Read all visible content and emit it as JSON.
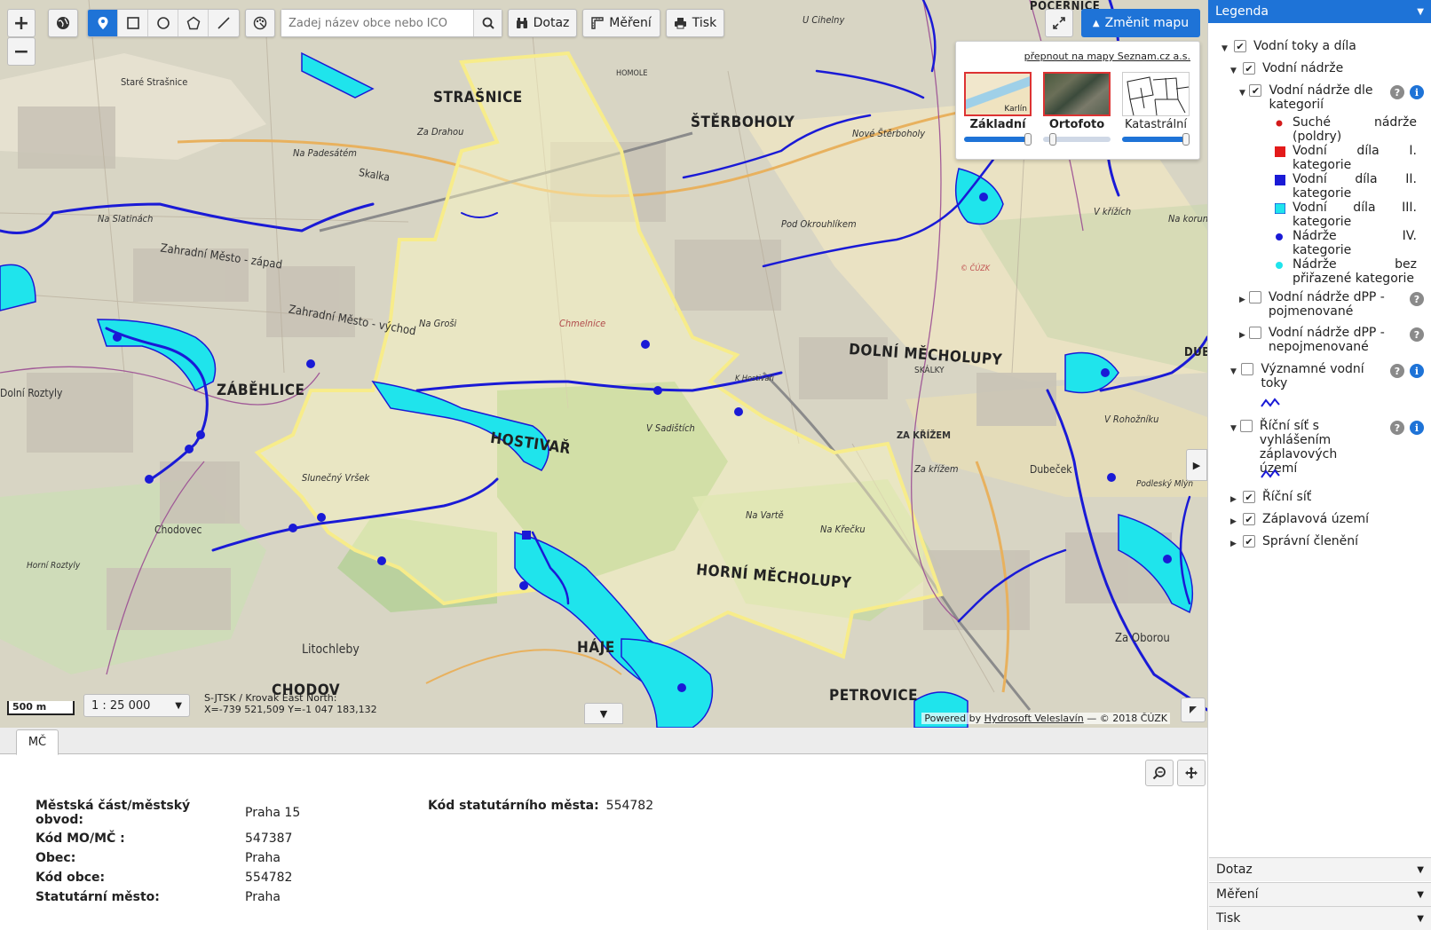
{
  "toolbar": {
    "zoom_in": "+",
    "zoom_out": "−",
    "search_placeholder": "Zadej název obce nebo IČO",
    "query_label": "Dotaz",
    "measure_label": "Měření",
    "print_label": "Tisk",
    "change_map_label": "Změnit mapu"
  },
  "switcher": {
    "link": "přepnout na mapy Seznam.cz a.s.",
    "options": [
      {
        "label": "Základní",
        "thumb_text": "Karlín",
        "opacity": 1.0
      },
      {
        "label": "Ortofoto",
        "opacity": 0.1
      },
      {
        "label": "Katastrální",
        "opacity": 1.0
      }
    ]
  },
  "map": {
    "labels": {
      "strasnice": "STRAŠNICE",
      "sterboholy": "ŠTĚRBOHOLY",
      "zabehlice": "ZÁBĚHLICE",
      "hostivar": "HOSTIVAŘ",
      "dolni_mecholupy": "DOLNÍ MĚCHOLUPY",
      "horni_mecholupy": "HORNÍ MĚCHOLUPY",
      "haje": "HÁJE",
      "chodov": "CHODOV",
      "petrovice": "PETROVICE",
      "pocernice": "POČERNICE",
      "dubec": "DUBEČ",
      "stare_strasnice": "Staré Strašnice",
      "zahradni_mesto_zapad": "Zahradní Město - západ",
      "zahradni_mesto_vychod": "Zahradní Město - východ",
      "skalka": "Skalka",
      "za_drahou": "Za Drahou",
      "na_padesatem": "Na Padesátém",
      "na_slatinach": "Na Slatinách",
      "na_grosi": "Na Groši",
      "chmelnice": "Chmelnice",
      "u_cihelny": "U Cihelny",
      "homole": "HOMOLE",
      "nove_sterboholy": "Nové Štěrboholy",
      "pod_okrouhlikem": "Pod Okrouhlíkem",
      "v_krizich": "V křížích",
      "na_korunce": "Na korunce",
      "skalky": "SKÁLKY",
      "za_krizem": "ZA KŘÍŽEM",
      "za_krizem2": "Za křížem",
      "v_sadistich": "V Sadištích",
      "slunecny_vrsek": "Slunečný Vršek",
      "chodovec": "Chodovec",
      "horni_roztyly": "Horní Roztyly",
      "dolni_roztyly": "Dolní Roztyly",
      "litochleby": "Litochleby",
      "na_varte": "Na Vartě",
      "na_krecku": "Na Křečku",
      "dubecek": "Dubeček",
      "podlesky_mlyn": "Podleský Mlýn",
      "za_oborou": "Za Oborou",
      "v_rohozniku": "V Rohožníku",
      "k_hostivari": "K Hostivaři",
      "cuzk": "© ČÚZK"
    },
    "scale_bar": "500 m",
    "scale_select": "1 : 25 000",
    "coords_line1": "S-JTSK / Krovak East North:",
    "coords_line2": "X=-739 521,509 Y=-1 047 183,132",
    "powered_prefix": "Powered by ",
    "powered_link": "Hydrosoft Veleslavín",
    "powered_suffix": " — © 2018 ČÚZK"
  },
  "info": {
    "tab": "MČ",
    "rows": [
      {
        "key": "Městská část/městský obvod:",
        "value": "Praha 15"
      },
      {
        "key": "Kód MO/MČ :",
        "value": "547387"
      },
      {
        "key": "Obec:",
        "value": "Praha"
      },
      {
        "key": "Kód obce:",
        "value": "554782"
      },
      {
        "key": "Statutární město:",
        "value": "Praha"
      }
    ],
    "extra_key": "Kód statutárního města:",
    "extra_value": "554782"
  },
  "legend": {
    "title": "Legenda",
    "items": {
      "vodni_toky": "Vodní toky a díla",
      "vodni_nadrze": "Vodní nádrže",
      "vodni_nadrze_kat": "Vodní nádrže dle kategorií",
      "sym_suche": "Suché nádrže (poldry)",
      "sym_kat1": "Vodní díla I. kategorie",
      "sym_kat2": "Vodní díla II. kategorie",
      "sym_kat3": "Vodní díla III. kategorie",
      "sym_kat4": "Nádrže IV. kategorie",
      "sym_bez": "Nádrže bez přiřazené kategorie",
      "dpp_pojm": "Vodní nádrže dPP - pojmenované",
      "dpp_nepojm": "Vodní nádrže dPP - nepojmenované",
      "vyznamne": "Významné vodní toky",
      "ricni_zaplav": "Říční síť s vyhlášením záplavových území",
      "ricni_sit": "Říční síť",
      "zaplavova": "Záplavová území",
      "spravni": "Správní členění"
    },
    "accordion": [
      "Dotaz",
      "Měření",
      "Tisk"
    ]
  },
  "colors": {
    "accent": "#1e73d7",
    "boundary": "#f7ec8a",
    "river": "#1a1ad6",
    "flood": "#1fe4ec"
  }
}
